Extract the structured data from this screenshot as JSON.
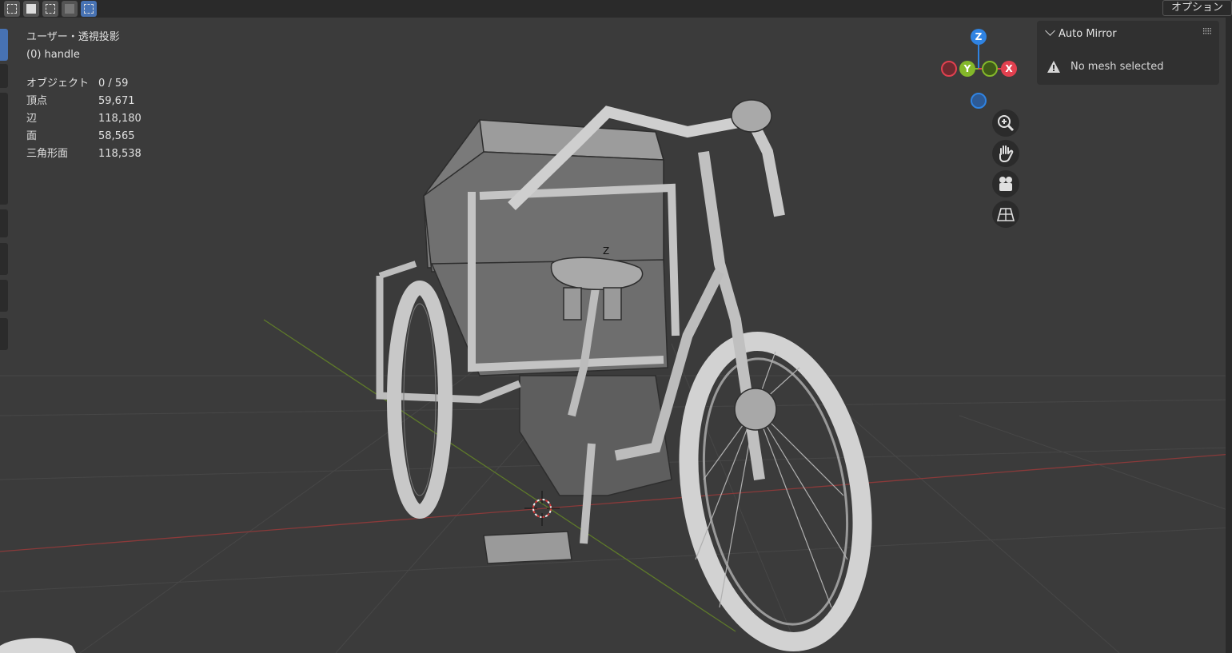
{
  "viewport": {
    "view_name": "ユーザー・透視投影",
    "active_object": "(0) handle",
    "stats": [
      {
        "label": "オブジェクト",
        "value": "0 / 59"
      },
      {
        "label": "頂点",
        "value": "59,671"
      },
      {
        "label": "辺",
        "value": "118,180"
      },
      {
        "label": "面",
        "value": "58,565"
      },
      {
        "label": "三角形面",
        "value": "118,538"
      }
    ]
  },
  "header": {
    "options_label": "オプション"
  },
  "gizmo": {
    "z_label": "Z",
    "y_label": "Y",
    "x_label": "X",
    "x_color": "#e2404f",
    "y_color": "#84b82a",
    "z_color": "#2f83e2"
  },
  "navigation_icons": [
    "zoom-icon",
    "hand-pan-icon",
    "camera-icon",
    "grid-perspective-icon"
  ],
  "auto_mirror_panel": {
    "title": "Auto Mirror",
    "message": "No mesh selected"
  },
  "model": {
    "axis_label": "Z"
  }
}
